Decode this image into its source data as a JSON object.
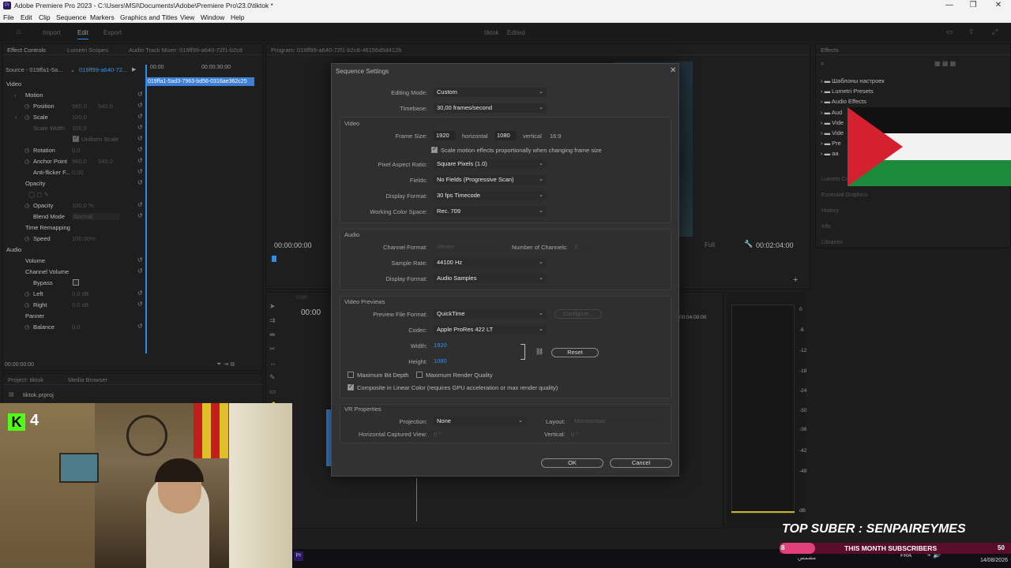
{
  "window": {
    "title": "Adobe Premiere Pro 2023 - C:\\Users\\MSI\\Documents\\Adobe\\Premiere Pro\\23.0\\tiktok *",
    "app_icon_text": "Pr"
  },
  "menu": [
    "File",
    "Edit",
    "Clip",
    "Sequence",
    "Markers",
    "Graphics and Titles",
    "View",
    "Window",
    "Help"
  ],
  "workspace": {
    "tabs": [
      "Import",
      "Edit",
      "Export"
    ],
    "active": "Edit",
    "project_title": "tiktok",
    "project_state": "Edited"
  },
  "effect_controls": {
    "tabs": [
      "Effect Controls",
      "Lumetri Scopes",
      "Audio Track Mixer: 019ff99-a640-72f1-b2c8"
    ],
    "source_label": "Source - 019ffa1-5a...",
    "sequence_link": "019ff99-a640-72...",
    "clip_name": "019ffa1-5ad3-7963-bd56-0316ae362c25",
    "timecode_start": "00:00",
    "timecode_mid": "00:00:30:00",
    "bottom_timecode": "00:00:00:00",
    "video_header": "Video",
    "audio_header": "Audio",
    "rows": {
      "motion": "Motion",
      "position": "Position",
      "position_x": "960,0",
      "position_y": "540,0",
      "scale": "Scale",
      "scale_val": "100,0",
      "scale_width": "Scale Width",
      "scale_width_val": "100,0",
      "uniform_scale": "Uniform Scale",
      "rotation": "Rotation",
      "rotation_val": "0,0",
      "anchor": "Anchor Point",
      "anchor_x": "960,0",
      "anchor_y": "540,0",
      "antiflicker": "Anti-flicker F...",
      "antiflicker_val": "0,00",
      "opacity_group": "Opacity",
      "opacity": "Opacity",
      "opacity_val": "100,0 %",
      "blend": "Blend Mode",
      "blend_val": "Normal",
      "time_remap": "Time Remapping",
      "speed": "Speed",
      "speed_val": "100,00%",
      "volume": "Volume",
      "channel_volume": "Channel Volume",
      "bypass": "Bypass",
      "left": "Left",
      "left_val": "0,0 dB",
      "right": "Right",
      "right_val": "0,0 dB",
      "panner": "Panner",
      "balance": "Balance",
      "balance_val": "0,0"
    }
  },
  "program_monitor": {
    "tab": "Program: 019ff99-a640-72f1-b2c8-48156d5d412b",
    "timecode_left": "00:00:00:00",
    "fit_label": "Full",
    "timecode_right": "00:02:04:00"
  },
  "effects_panel": {
    "tab": "Effects",
    "items": [
      "Шаблоны настроек",
      "Lumetri Presets",
      "Audio Effects",
      "Aud",
      "Vide",
      "Vide",
      "Pre",
      "aa"
    ],
    "more_panels": [
      "Lumetri Co",
      "Essential Graphics",
      "History",
      "Info",
      "Libraries"
    ]
  },
  "project_panel": {
    "tabs": [
      "Project: tiktok",
      "Media Browser"
    ],
    "file": "tiktok.prproj"
  },
  "timeline": {
    "timecode": "00:00",
    "ruler_mark": "00:04:00:00",
    "tab_hint": "019ff"
  },
  "meters": {
    "labels": [
      "0",
      "-6",
      "-12",
      "-18",
      "-24",
      "-30",
      "-36",
      "-42",
      "-48",
      "dB"
    ]
  },
  "dialog": {
    "title": "Sequence Settings",
    "editing_mode_label": "Editing Mode:",
    "editing_mode": "Custom",
    "timebase_label": "Timebase:",
    "timebase": "30,00  frames/second",
    "video_section": "Video",
    "frame_size_label": "Frame Size:",
    "frame_w": "1920",
    "horizontal": "horizontal",
    "frame_h": "1080",
    "vertical": "vertical",
    "aspect": "16:9",
    "scale_motion_label": "Scale motion effects proportionally when changing frame size",
    "par_label": "Pixel Aspect Ratio:",
    "par": "Square Pixels (1.0)",
    "fields_label": "Fields:",
    "fields": "No Fields (Progressive Scan)",
    "display_format_label": "Display Format:",
    "display_format": "30 fps Timecode",
    "color_space_label": "Working Color Space:",
    "color_space": "Rec. 709",
    "audio_section": "Audio",
    "channel_format_label": "Channel Format:",
    "channel_format": "Stereo",
    "num_channels_label": "Number of Channels:",
    "num_channels": "2",
    "sample_rate_label": "Sample Rate:",
    "sample_rate": "44100 Hz",
    "audio_display_label": "Display Format:",
    "audio_display": "Audio Samples",
    "previews_section": "Video Previews",
    "preview_format_label": "Preview File Format:",
    "preview_format": "QuickTime",
    "configure": "Configure...",
    "codec_label": "Codec:",
    "codec": "Apple ProRes 422 LT",
    "width_label": "Width:",
    "width": "1920",
    "height_label": "Height:",
    "height": "1080",
    "reset": "Reset",
    "max_bit_depth": "Maximum Bit Depth",
    "max_render_quality": "Maximum Render Quality",
    "composite_linear": "Composite in Linear Color (requires GPU acceleration or max render quality)",
    "vr_section": "VR Properties",
    "projection_label": "Projection:",
    "projection": "None",
    "layout_label": "Layout:",
    "layout": "Monoscopic",
    "hcv_label": "Horizontal Captured View:",
    "hcv": "0 °",
    "vertical_label": "Vertical:",
    "vertical_val": "0 °",
    "ok": "OK",
    "cancel": "Cancel"
  },
  "overlay": {
    "kick_badge": "K",
    "kick_count": "4",
    "top_suber": "TOP SUBER : SENPAIREYMES",
    "subs_label": "THIS MONTH SUBSCRIBERS",
    "subs_count": "8",
    "subs_goal": "50"
  },
  "taskbar": {
    "lang": "FRA",
    "time": "10:50",
    "date": "14/08/2026",
    "weather_text": "مشمس"
  },
  "colors": {
    "accent": "#2d8ceb",
    "link": "#3d8fe0",
    "dialog_bg": "#323232",
    "panel_bg": "#1e1e1e"
  }
}
